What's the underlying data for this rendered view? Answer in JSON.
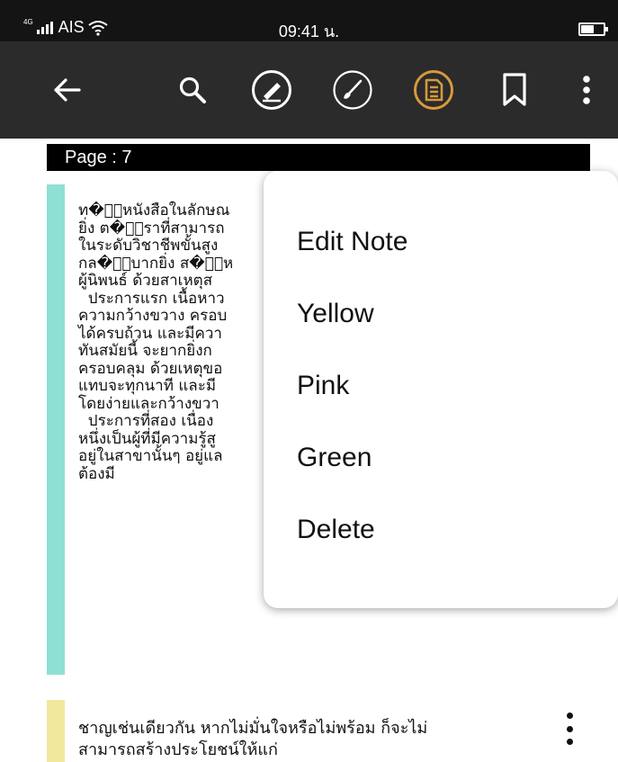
{
  "status_bar": {
    "signal_label": "4G",
    "carrier": "AIS",
    "time": "09:41 น."
  },
  "toolbar": {
    "icons": [
      "back-arrow-icon",
      "search-icon",
      "pen-circle-icon",
      "brush-circle-icon",
      "note-circle-icon",
      "bookmark-icon",
      "more-vert-icon"
    ],
    "active_color": "#d79a3b"
  },
  "reader": {
    "page_label": "Page : 7",
    "note_1": {
      "text": "ท�ำหนังสือในลักษณ\nยิ่ง ต�ำราที่สามารถ\nในระดับวิชาชีพขั้นสูง\nกล�ำบากยิ่ง ส�ำห\nผู้นิพนธ์ ด้วยสาเหตุส\n  ประการแรก เนื้อหาว\nความกว้างขวาง ครอบ\nได้ครบถ้วน และมีควา\nทันสมัยนี้ จะยากยิ่งก\nครอบคลุม ด้วยเหตุขอ\nแทบจะทุกนาที และมี\nโดยง่ายและกว้างขวา\n  ประการที่สอง เนื่อง\nหนึ่งเป็นผู้ที่มีความรู้สู\nอยู่ในสาขานั้นๆ อยู่แล\nต้องมี",
      "highlight_color": "#8fe0d4"
    },
    "note_2": {
      "text": "ชาญเช่นเดียวกัน หากไม่มั่นใจหรือไม่พร้อม ก็จะไม่\nสามารถสร้างประโยชน์ให้แก่",
      "highlight_color": "#f1e79d"
    }
  },
  "context_menu": {
    "items": [
      "Edit Note",
      "Yellow",
      "Pink",
      "Green",
      "Delete"
    ]
  }
}
